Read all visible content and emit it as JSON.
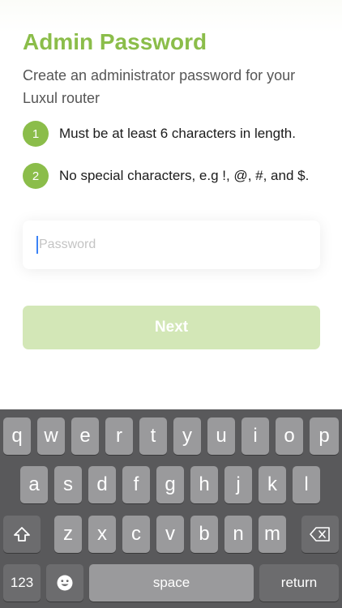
{
  "header": {
    "title": "Admin Password",
    "subtitle": "Create an administrator password for your Luxul router"
  },
  "requirements": [
    {
      "number": "1",
      "text": "Must be at least 6 characters in length."
    },
    {
      "number": "2",
      "text": "No special characters, e.g !, @, #, and $."
    }
  ],
  "password_field": {
    "placeholder": "Password",
    "value": ""
  },
  "next_button": {
    "label": "Next"
  },
  "colors": {
    "accent": "#8bbd4a",
    "button_disabled": "#d3e7b7",
    "keyboard_bg": "#59595b"
  },
  "keyboard": {
    "row1": [
      "q",
      "w",
      "e",
      "r",
      "t",
      "y",
      "u",
      "i",
      "o",
      "p"
    ],
    "row2": [
      "a",
      "s",
      "d",
      "f",
      "g",
      "h",
      "j",
      "k",
      "l"
    ],
    "row3": [
      "z",
      "x",
      "c",
      "v",
      "b",
      "n",
      "m"
    ],
    "shift_icon": "shift-icon",
    "delete_icon": "backspace-icon",
    "numbers_label": "123",
    "emoji_icon": "emoji-icon",
    "space_label": "space",
    "return_label": "return"
  }
}
